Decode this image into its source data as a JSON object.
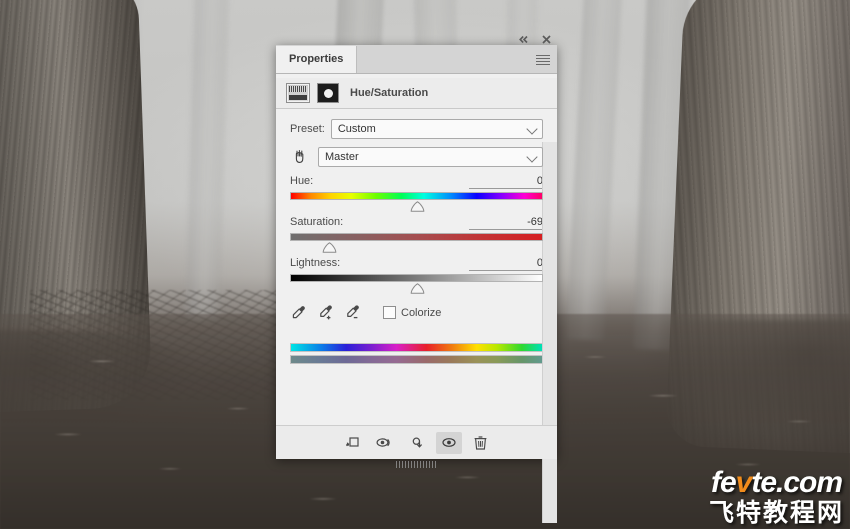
{
  "background": {
    "description": "foggy-forest-photo",
    "alt": "Desaturated foggy forest with large tree trunks and leaf-covered ground"
  },
  "panel": {
    "tab_label": "Properties",
    "collapse_icon": "«",
    "close_icon": "×",
    "menu_icon": "hamburger-menu-icon",
    "adjustment_title": "Hue/Saturation",
    "adjustment_icon": "hue-saturation-adjustment-icon",
    "mask_icon": "layer-mask-thumbnail-icon",
    "preset": {
      "label": "Preset:",
      "value": "Custom"
    },
    "channel": {
      "value": "Master",
      "hand_tool_icon": "on-image-adjustment-hand-icon"
    },
    "sliders": [
      {
        "name": "Hue:",
        "value": "0",
        "position_pct": 50
      },
      {
        "name": "Saturation:",
        "value": "-69",
        "position_pct": 15.5
      },
      {
        "name": "Lightness:",
        "value": "0",
        "position_pct": 50
      }
    ],
    "tools": {
      "eyedropper": "eyedropper-icon",
      "eyedropper_add": "eyedropper-add-icon",
      "eyedropper_subtract": "eyedropper-subtract-icon",
      "colorize_label": "Colorize",
      "colorize_checked": false
    },
    "footer_buttons": [
      {
        "name": "clip-to-layer-button",
        "icon": "clip-to-layer-icon",
        "active": false
      },
      {
        "name": "view-previous-state-button",
        "icon": "eye-previous-state-icon",
        "active": false
      },
      {
        "name": "reset-button",
        "icon": "reset-arrow-icon",
        "active": false
      },
      {
        "name": "toggle-visibility-button",
        "icon": "eye-icon",
        "active": true
      },
      {
        "name": "delete-adjustment-button",
        "icon": "trash-icon",
        "active": false
      }
    ]
  },
  "watermark": {
    "line1_a": "fe",
    "line1_b": "v",
    "line1_c": "te.com",
    "line2": "飞特教程网"
  },
  "colors": {
    "panel_bg": "#f0f0f0",
    "tabstrip_bg": "#d4d4d4",
    "accent_red": "#d61f22",
    "text": "#4a4a4a"
  }
}
